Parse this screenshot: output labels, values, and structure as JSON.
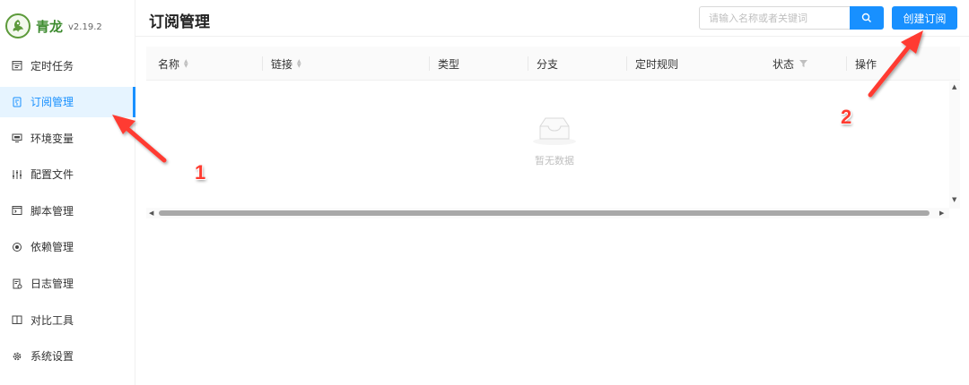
{
  "brand": {
    "name": "青龙",
    "version": "v2.19.2"
  },
  "sidebar": {
    "items": [
      {
        "label": "定时任务",
        "icon": "calendar-icon",
        "active": false
      },
      {
        "label": "订阅管理",
        "icon": "subscription-icon",
        "active": true
      },
      {
        "label": "环境变量",
        "icon": "monitor-icon",
        "active": false
      },
      {
        "label": "配置文件",
        "icon": "sliders-icon",
        "active": false
      },
      {
        "label": "脚本管理",
        "icon": "code-window-icon",
        "active": false
      },
      {
        "label": "依赖管理",
        "icon": "dependency-icon",
        "active": false
      },
      {
        "label": "日志管理",
        "icon": "log-file-icon",
        "active": false
      },
      {
        "label": "对比工具",
        "icon": "book-compare-icon",
        "active": false
      },
      {
        "label": "系统设置",
        "icon": "gear-icon",
        "active": false
      }
    ]
  },
  "header": {
    "title": "订阅管理",
    "search_placeholder": "请输入名称或者关键词",
    "create_label": "创建订阅"
  },
  "table": {
    "columns": [
      "名称",
      "链接",
      "类型",
      "分支",
      "定时规则",
      "状态",
      "操作"
    ],
    "empty_text": "暂无数据"
  },
  "annotations": [
    "1",
    "2"
  ],
  "colors": {
    "primary": "#1890ff",
    "annotation": "#ff3b30",
    "brand": "#3d8b2f"
  }
}
